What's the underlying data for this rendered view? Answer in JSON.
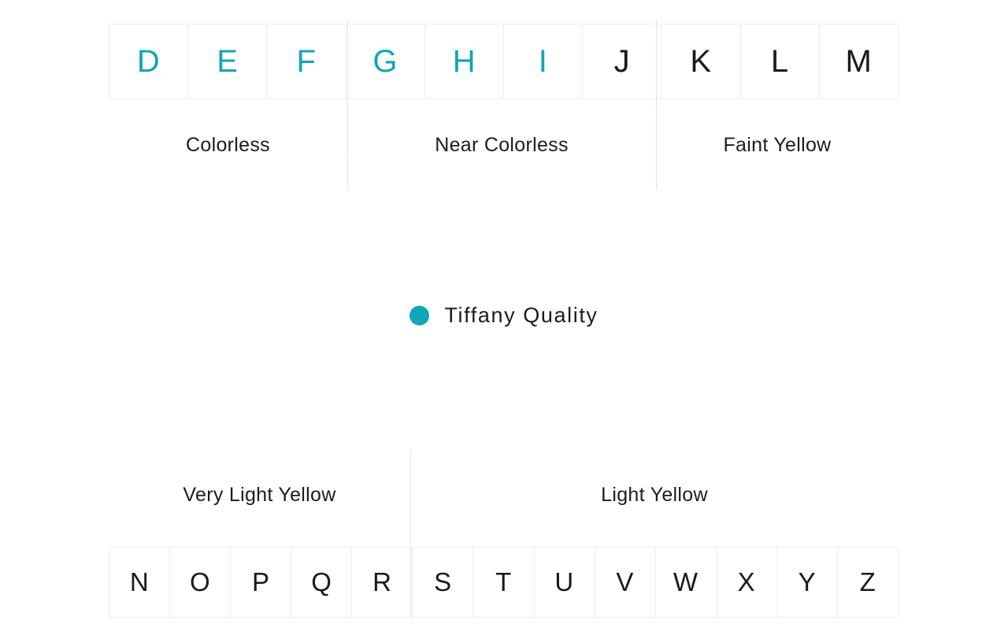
{
  "theme": {
    "tiffany_teal": "#0fa6b8",
    "text_color": "#1c1c1c",
    "cell_border": "#ececec",
    "divider_color": "#c9c9c9",
    "background": "#ffffff"
  },
  "legend": {
    "dot_icon": "filled-circle-icon",
    "label": "Tiffany Quality",
    "dot_color": "#0fa6b8"
  },
  "top_scale": {
    "grades": [
      {
        "letter": "D",
        "tiffany": true
      },
      {
        "letter": "E",
        "tiffany": true
      },
      {
        "letter": "F",
        "tiffany": true
      },
      {
        "letter": "G",
        "tiffany": true
      },
      {
        "letter": "H",
        "tiffany": true
      },
      {
        "letter": "I",
        "tiffany": true
      },
      {
        "letter": "J",
        "tiffany": false
      },
      {
        "letter": "K",
        "tiffany": false
      },
      {
        "letter": "L",
        "tiffany": false
      },
      {
        "letter": "M",
        "tiffany": false
      }
    ],
    "sections": [
      {
        "label": "Colorless",
        "grades": "D-F"
      },
      {
        "label": "Near Colorless",
        "grades": "G-J"
      },
      {
        "label": "Faint Yellow",
        "grades": "K-M"
      }
    ]
  },
  "bottom_scale": {
    "grades": [
      {
        "letter": "N",
        "tiffany": false
      },
      {
        "letter": "O",
        "tiffany": false
      },
      {
        "letter": "P",
        "tiffany": false
      },
      {
        "letter": "Q",
        "tiffany": false
      },
      {
        "letter": "R",
        "tiffany": false
      },
      {
        "letter": "S",
        "tiffany": false
      },
      {
        "letter": "T",
        "tiffany": false
      },
      {
        "letter": "U",
        "tiffany": false
      },
      {
        "letter": "V",
        "tiffany": false
      },
      {
        "letter": "W",
        "tiffany": false
      },
      {
        "letter": "X",
        "tiffany": false
      },
      {
        "letter": "Y",
        "tiffany": false
      },
      {
        "letter": "Z",
        "tiffany": false
      }
    ],
    "sections": [
      {
        "label": "Very Light Yellow",
        "grades": "N-R"
      },
      {
        "label": "Light Yellow",
        "grades": "S-Z"
      }
    ]
  }
}
